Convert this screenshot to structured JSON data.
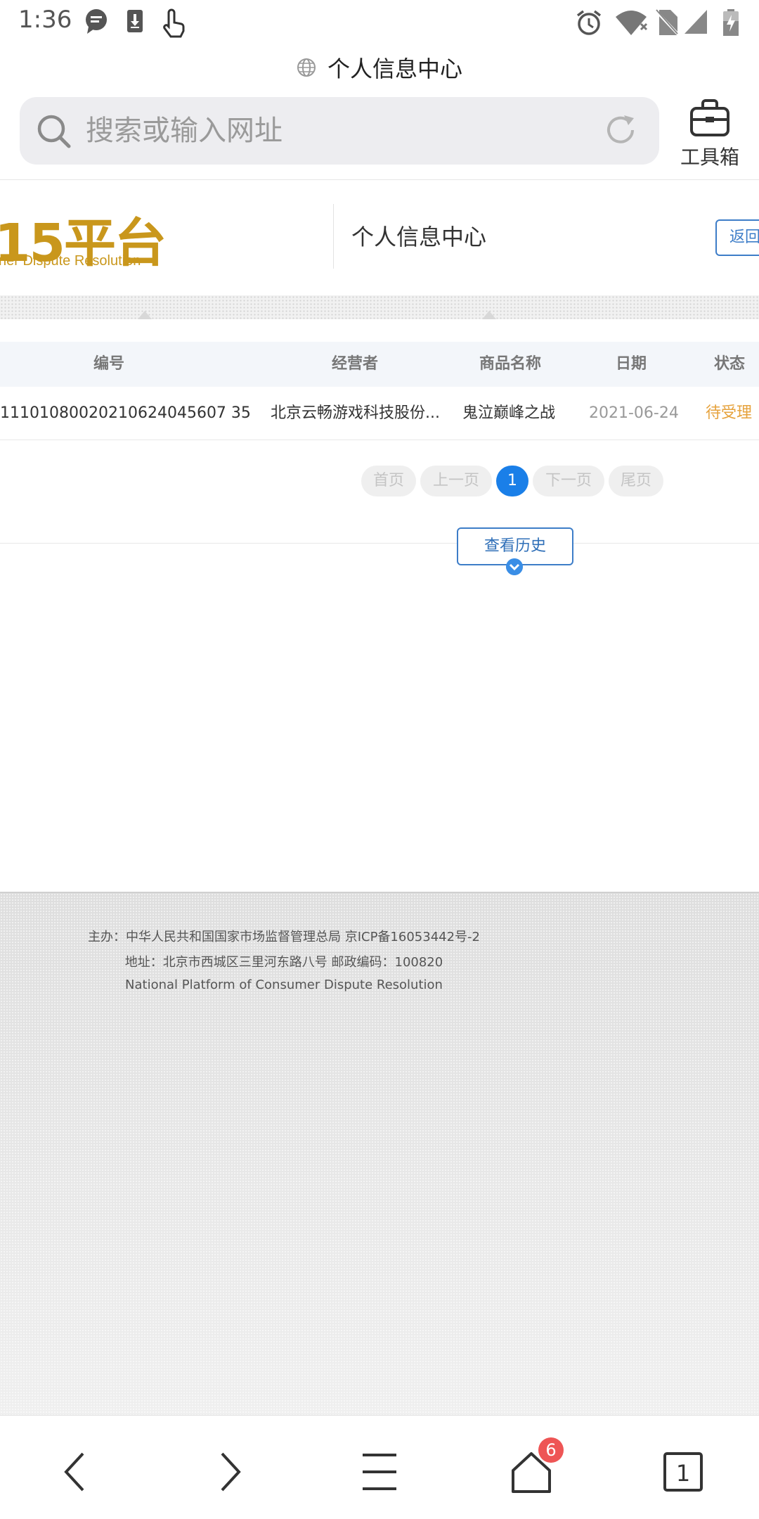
{
  "status_bar": {
    "time": "1:36",
    "icons": [
      "chat-bubble-icon",
      "download-icon",
      "touch-hand-icon",
      "alarm-icon",
      "wifi-icon",
      "no-sim-icon",
      "cell-signal-icon",
      "battery-charging-icon"
    ]
  },
  "browser": {
    "page_title": "个人信息中心",
    "search_placeholder": "搜索或输入网址",
    "toolbox_label": "工具箱"
  },
  "site_header": {
    "logo_text": "15平台",
    "logo_subtitle": "ner Dispute Resolution",
    "title": "个人信息中心",
    "back_label": "返回"
  },
  "table": {
    "headers": [
      "编号",
      "经营者",
      "商品名称",
      "日期",
      "状态"
    ],
    "rows": [
      {
        "id": "11101080020210624045607 35",
        "operator": "北京云畅游戏科技股份...",
        "product": "鬼泣巅峰之战",
        "date": "2021-06-24",
        "status": "待受理"
      }
    ]
  },
  "pagination": {
    "first": "首页",
    "prev": "上一页",
    "current": "1",
    "next": "下一页",
    "last": "尾页"
  },
  "history_button": "查看历史",
  "footer": {
    "line1": "主办：中华人民共和国国家市场监督管理总局 京ICP备16053442号-2",
    "line2": "地址：北京市西城区三里河东路八号 邮政编码：100820",
    "line3": "National Platform of Consumer Dispute Resolution"
  },
  "bottom_nav": {
    "home_badge": "6",
    "tabs_count": "1"
  },
  "colors": {
    "accent_blue": "#1a7fe8",
    "logo_gold": "#c9971c",
    "status_orange": "#e6a23c",
    "badge_red": "#ee5555"
  }
}
